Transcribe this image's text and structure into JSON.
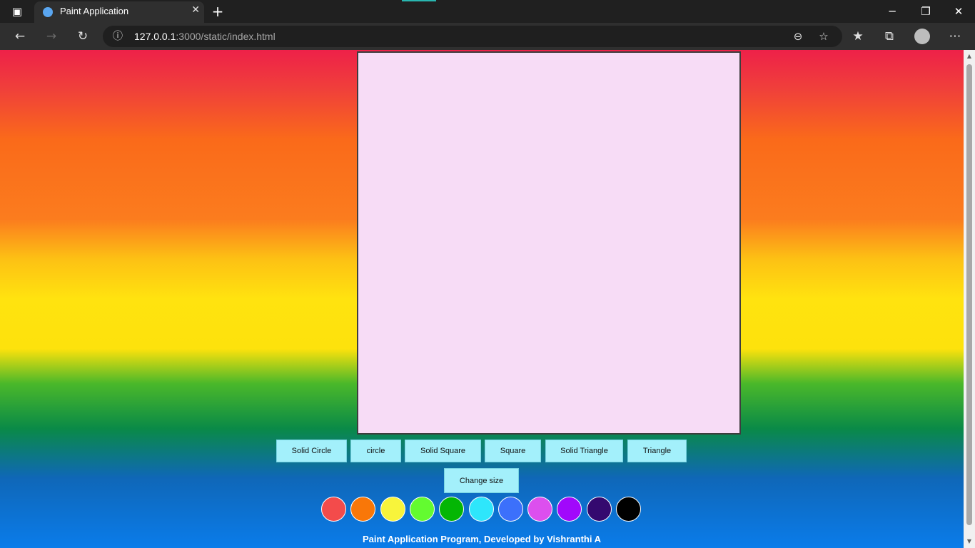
{
  "browser": {
    "tab_title": "Paint Application",
    "url_host": "127.0.0.1",
    "url_path": ":3000/static/index.html"
  },
  "app": {
    "buttons": [
      {
        "label": "Solid Circle"
      },
      {
        "label": "circle"
      },
      {
        "label": "Solid Square"
      },
      {
        "label": "Square"
      },
      {
        "label": "Solid Triangle"
      },
      {
        "label": "Triangle"
      },
      {
        "label": "Change size"
      }
    ],
    "colors": [
      "#f34b4b",
      "#f97708",
      "#f8f43b",
      "#63fb30",
      "#04b604",
      "#2ee6fb",
      "#3c70fb",
      "#dc4fee",
      "#a108fb",
      "#34096f",
      "#000000"
    ],
    "footer": "Paint Application Program, Developed by Vishranthi A"
  },
  "theme": {
    "canvas_bg": "#f7dcf6",
    "button_bg": "#a3f0fb"
  }
}
